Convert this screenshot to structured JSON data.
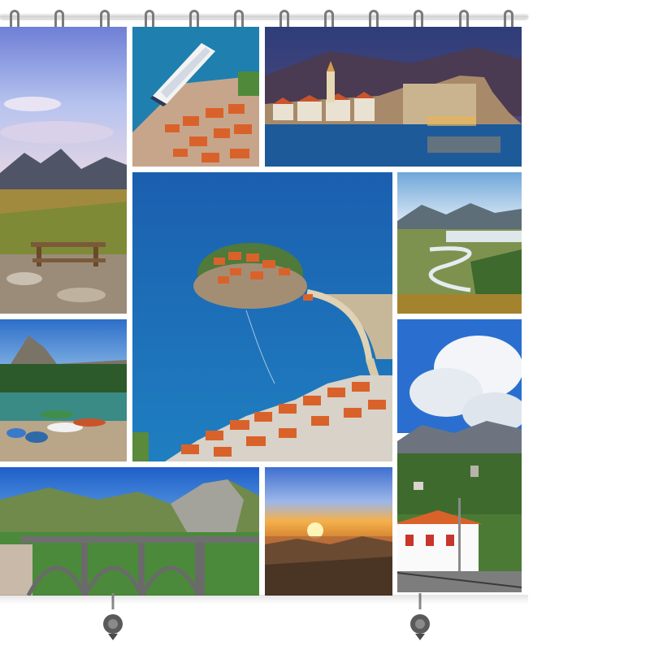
{
  "rings": {
    "count": 12,
    "icon": "curtain-ring-icon"
  },
  "panels": [
    {
      "name": "mountain-bench-photo",
      "subject": "mountain-bench"
    },
    {
      "name": "cruise-ship-harbor-photo",
      "subject": "cruise-ship"
    },
    {
      "name": "old-town-night-photo",
      "subject": "old-town"
    },
    {
      "name": "island-peninsula-photo",
      "subject": "island"
    },
    {
      "name": "river-valley-photo",
      "subject": "river"
    },
    {
      "name": "lake-boats-photo",
      "subject": "lake-boats"
    },
    {
      "name": "clouds-village-photo",
      "subject": "clouds-village"
    },
    {
      "name": "arch-bridge-photo",
      "subject": "bridge"
    },
    {
      "name": "sunset-coast-photo",
      "subject": "sunset"
    }
  ],
  "colors": {
    "sea": "#1f6fb8",
    "sky": "#3d8fd8",
    "roof": "#d9622b",
    "mountain": "#6a6f7a",
    "grass": "#8a9a3a"
  }
}
